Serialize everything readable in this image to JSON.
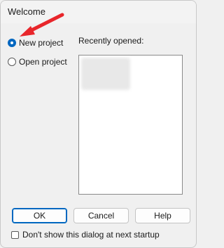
{
  "window": {
    "title": "Welcome"
  },
  "options": {
    "new_project": {
      "label": "New project",
      "checked": true
    },
    "open_project": {
      "label": "Open project",
      "checked": false
    }
  },
  "recent": {
    "label": "Recently opened:"
  },
  "buttons": {
    "ok": "OK",
    "cancel": "Cancel",
    "help": "Help"
  },
  "startup_checkbox": {
    "label": "Don't show this dialog at next startup",
    "checked": false
  },
  "colors": {
    "accent": "#0067c0",
    "annotation_arrow": "#e8262b"
  }
}
